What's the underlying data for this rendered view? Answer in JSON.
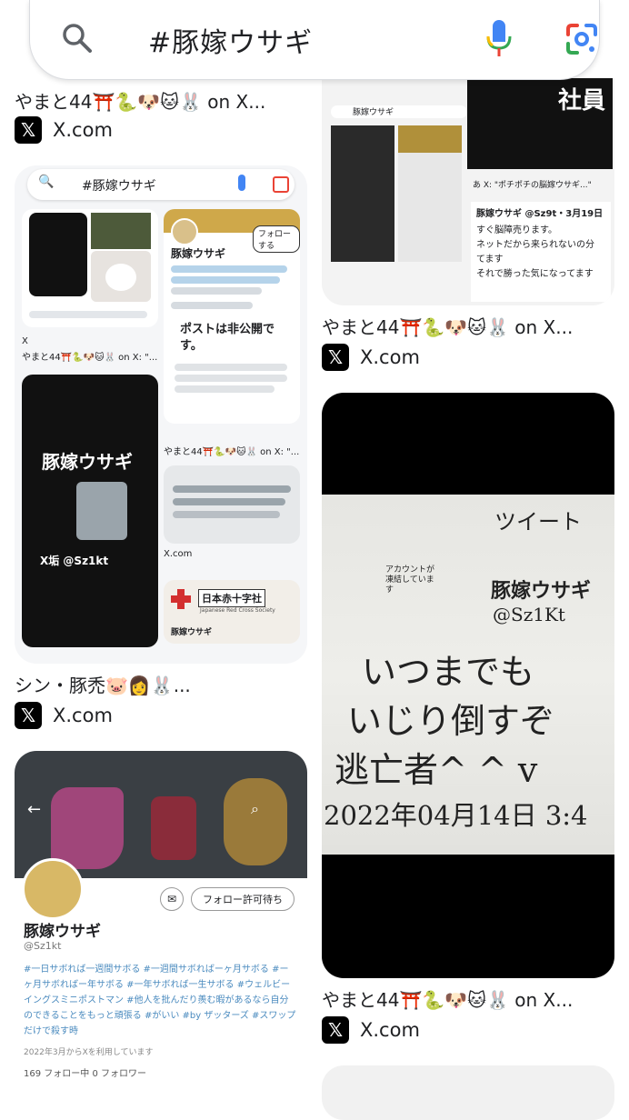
{
  "search": {
    "query": "#豚嫁ウサギ"
  },
  "results": [
    {
      "caption": "やまと44⛩️🐍🐶🐱🐰 on X...",
      "source": "X.com"
    },
    {
      "caption": "やまと44⛩️🐍🐶🐱🐰 on X...",
      "source": "X.com"
    },
    {
      "caption": "シン・豚禿🐷👩🐰...",
      "source": "X.com"
    },
    {
      "caption": "やまと44⛩️🐍🐶🐱🐰 on X...",
      "source": "X.com"
    }
  ],
  "thumb_main": {
    "query": "#豚嫁ウサギ",
    "profile_name": "豚嫁ウサギ",
    "follow": "フォローする",
    "posts_private": "ポストは非公開です。",
    "x_label": "X",
    "small_caption_a": "やまと44⛩️🐍🐶🐱🐰 on X: \"...",
    "small_caption_b": "やまと44⛩️🐍🐶🐱🐰 on X: \"...",
    "xcom": "X.com",
    "shirt_title": "豚嫁ウサギ",
    "shirt_handle": "X垢 @Sz1kt",
    "red_cross": "日本赤十字社",
    "red_cross_sub": "Japanese Red Cross Society",
    "profile_footer": "豚嫁ウサギ"
  },
  "thumb_top_right": {
    "query": "豚嫁ウサギ",
    "profile": "豚嫁ウサギ @Sz9t・3月19日",
    "line1": "すぐ脳障売ります。",
    "line2": "ネットだから来られないの分",
    "line3": "てます",
    "line4": "それで勝った気になってます",
    "post": "あ X: \"ポチポチの脳嫁ウサギ...\""
  },
  "thumb_photo": {
    "tweet": "ツイート",
    "acct": "アカウントが凍結しています",
    "name": "豚嫁ウサギ",
    "handle": "@Sz1Kt",
    "line1": "いつまでも",
    "line2": "いじり倒すぞ",
    "line3": "逃亡者^ ^ v",
    "date": "2022年04月14日 3:4"
  },
  "thumb_profile": {
    "name": "豚嫁ウサギ",
    "handle": "@Sz1kt",
    "button": "フォロー許可待ち",
    "bio": "#一日サボれば一週間サボる #一週間サボればーヶ月サボる #ーヶ月サボればー年サボる #一年サボれば一生サボる #ウェルビーイングスミニポストマン #他人を批んだり羨む暇があるなら自分のできることをもっと頑張る #がいい #by ザッターズ #スワップだけで殺す時",
    "joined": "2022年3月からXを利用しています",
    "stats": "169 フォロー中  0 フォロワー"
  }
}
